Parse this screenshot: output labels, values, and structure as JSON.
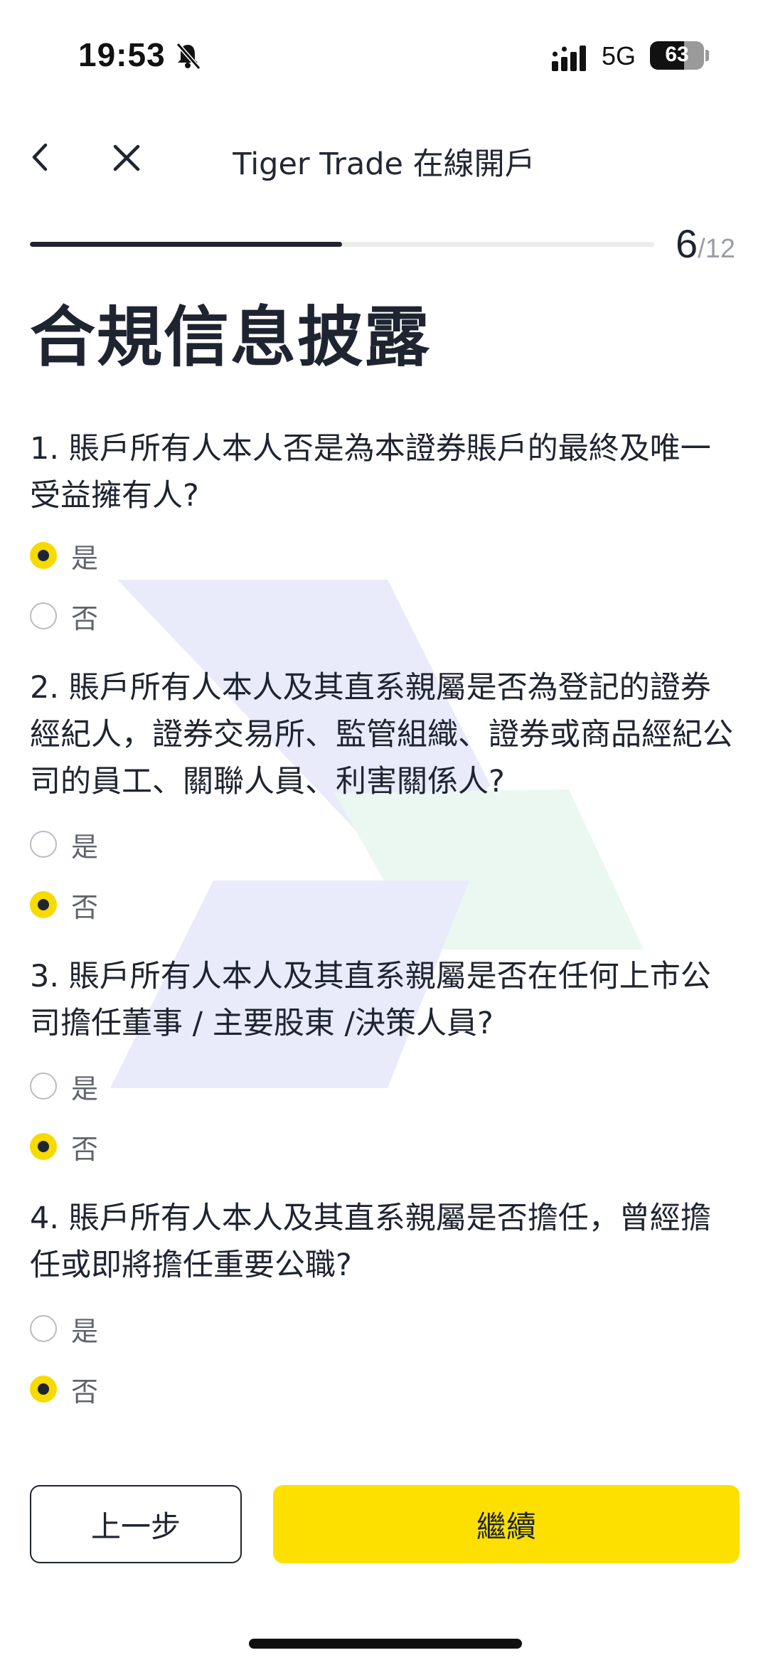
{
  "status_bar": {
    "time": "19:53",
    "network": "5G",
    "battery": "63",
    "battery_level": 0.63,
    "icons": [
      "bell-slash-icon",
      "signal-icon",
      "battery-icon"
    ]
  },
  "nav": {
    "title": "Tiger Trade 在線開戶",
    "icons": [
      "chevron-left-icon",
      "close-icon"
    ]
  },
  "progress": {
    "current": "6",
    "total": "/12",
    "fraction": 0.5
  },
  "page_title": "合規信息披露",
  "questions": [
    {
      "text": "1. 賬戶所有人本人否是為本證券賬戶的最終及唯一受益擁有人?",
      "options": [
        {
          "label": "是",
          "selected": true
        },
        {
          "label": "否",
          "selected": false
        }
      ]
    },
    {
      "text": "2. 賬戶所有人本人及其直系親屬是否為登記的證券經紀人，證券交易所、監管組織、證券或商品經紀公司的員工、關聯人員、利害關係人?",
      "options": [
        {
          "label": "是",
          "selected": false
        },
        {
          "label": "否",
          "selected": true
        }
      ]
    },
    {
      "text": "3. 賬戶所有人本人及其直系親屬是否在任何上市公司擔任董事 / 主要股東 /決策人員?",
      "options": [
        {
          "label": "是",
          "selected": false
        },
        {
          "label": "否",
          "selected": true
        }
      ]
    },
    {
      "text": "4. 賬戶所有人本人及其直系親屬是否擔任，曾經擔任或即將擔任重要公職?",
      "options": [
        {
          "label": "是",
          "selected": false
        },
        {
          "label": "否",
          "selected": true
        }
      ]
    }
  ],
  "buttons": {
    "prev": "上一步",
    "next": "繼續"
  },
  "colors": {
    "accent": "#FDE000",
    "text": "#1F2431",
    "watermark_blue": "#E8EAFB",
    "watermark_green": "#EAF8F1"
  }
}
